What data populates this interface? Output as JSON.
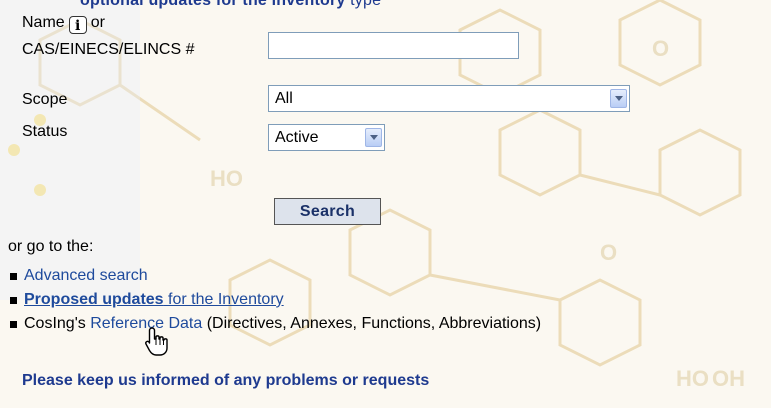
{
  "heading_clipped": {
    "bold": "optional updates for the inventory",
    "tail": "type"
  },
  "form": {
    "name_label_prefix": "Name",
    "name_label_suffix": "or",
    "info_icon_glyph": "i",
    "name_label_line2": "CAS/EINECS/ELINCS #",
    "name_value": "",
    "scope_label": "Scope",
    "scope_value": "All",
    "status_label": "Status",
    "status_value": "Active",
    "search_button": "Search"
  },
  "goto": {
    "intro": "or go to the:",
    "advanced_search": "Advanced search",
    "proposed_updates_bold": "Proposed updates",
    "proposed_updates_rest": " for the Inventory",
    "cosing_prefix": "CosIng's ",
    "reference_data": "Reference Data",
    "cosing_suffix": " (Directives, Annexes, Functions, Abbreviations)"
  },
  "feedback": "Please keep us informed of any problems or requests",
  "icons": {
    "info": "info-icon",
    "dropdown": "chevron-down-icon",
    "pointer": "hand-pointer-icon"
  },
  "colors": {
    "link": "#1e4a9c",
    "heading": "#1e3a8f",
    "button_bg": "#dde3ec"
  }
}
